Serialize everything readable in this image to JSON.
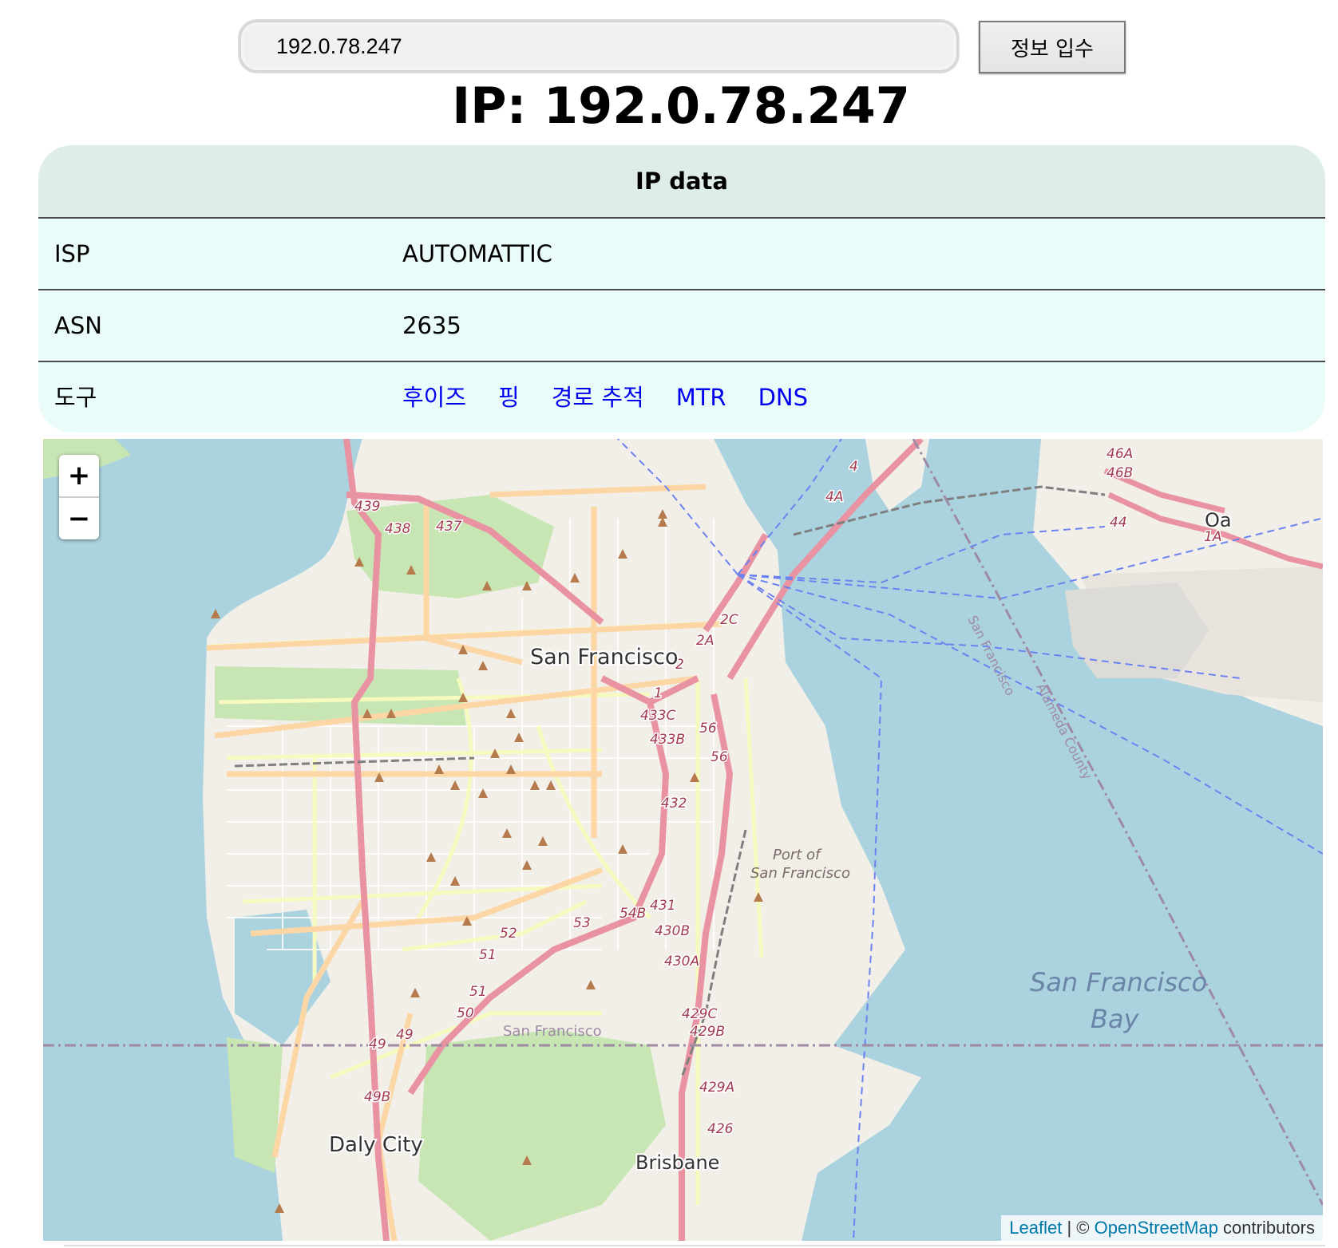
{
  "search": {
    "value": "192.0.78.247",
    "button_label": "정보 입수"
  },
  "page_title": "IP: 192.0.78.247",
  "ip_table": {
    "header": "IP data",
    "rows": [
      {
        "key": "ISP",
        "value": "AUTOMATTIC"
      },
      {
        "key": "ASN",
        "value": "2635"
      }
    ],
    "tools": {
      "key": "도구",
      "links": [
        "후이즈",
        "핑",
        "경로 추적",
        "MTR",
        "DNS"
      ]
    }
  },
  "map": {
    "zoom_in": "+",
    "zoom_out": "−",
    "labels": {
      "city": "San Francisco",
      "daly_city": "Daly City",
      "brisbane": "Brisbane",
      "bay_line1": "San Francisco",
      "bay_line2": "Bay",
      "port_line1": "Port of",
      "port_line2": "San Francisco",
      "county_sf": "San Francisco",
      "county_alameda": "Alameda County",
      "sf_boundary": "San Francisco",
      "oakland_partial": "Oa"
    },
    "exit_labels": [
      "439",
      "438",
      "437",
      "2C",
      "2A",
      "2",
      "1",
      "433C",
      "433B",
      "56",
      "56",
      "432",
      "431",
      "430B",
      "430A",
      "54B",
      "53",
      "52",
      "51",
      "51",
      "50",
      "49",
      "49",
      "49B",
      "429C",
      "429B",
      "429A",
      "426",
      "4",
      "4A",
      "46A",
      "46B",
      "44",
      "1A"
    ],
    "attribution": {
      "leaflet": "Leaflet",
      "sep": " | © ",
      "osm": "OpenStreetMap",
      "suffix": " contributors"
    },
    "colors": {
      "water": "#aad3df",
      "land": "#f2efe9",
      "park": "#c8e6b4",
      "motorway": "#e892a2",
      "primary": "#fcd6a4",
      "secondary": "#f7fabf",
      "ferry": "#6b82f0"
    }
  }
}
